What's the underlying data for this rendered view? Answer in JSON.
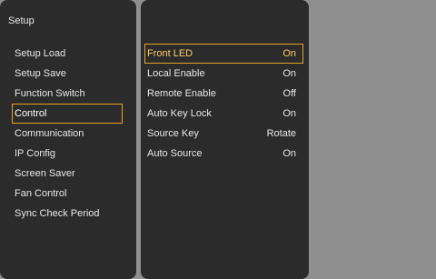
{
  "left_panel": {
    "title": "Setup",
    "items": [
      {
        "label": "Setup Load",
        "selected": false
      },
      {
        "label": "Setup Save",
        "selected": false
      },
      {
        "label": "Function Switch",
        "selected": false
      },
      {
        "label": "Control",
        "selected": true
      },
      {
        "label": "Communication",
        "selected": false
      },
      {
        "label": "IP Config",
        "selected": false
      },
      {
        "label": "Screen Saver",
        "selected": false
      },
      {
        "label": "Fan Control",
        "selected": false
      },
      {
        "label": "Sync Check Period",
        "selected": false
      }
    ]
  },
  "right_panel": {
    "options": [
      {
        "label": "Front LED",
        "value": "On",
        "selected": true
      },
      {
        "label": "Local Enable",
        "value": "On",
        "selected": false
      },
      {
        "label": "Remote Enable",
        "value": "Off",
        "selected": false
      },
      {
        "label": "Auto Key Lock",
        "value": "On",
        "selected": false
      },
      {
        "label": "Source Key",
        "value": "Rotate",
        "selected": false
      },
      {
        "label": "Auto Source",
        "value": "On",
        "selected": false
      }
    ]
  },
  "colors": {
    "background": "#8f8f8f",
    "panel": "#2b2b2b",
    "highlight_border": "#e8a324",
    "highlight_text": "#ffcb66",
    "text": "#e8e8e8"
  }
}
